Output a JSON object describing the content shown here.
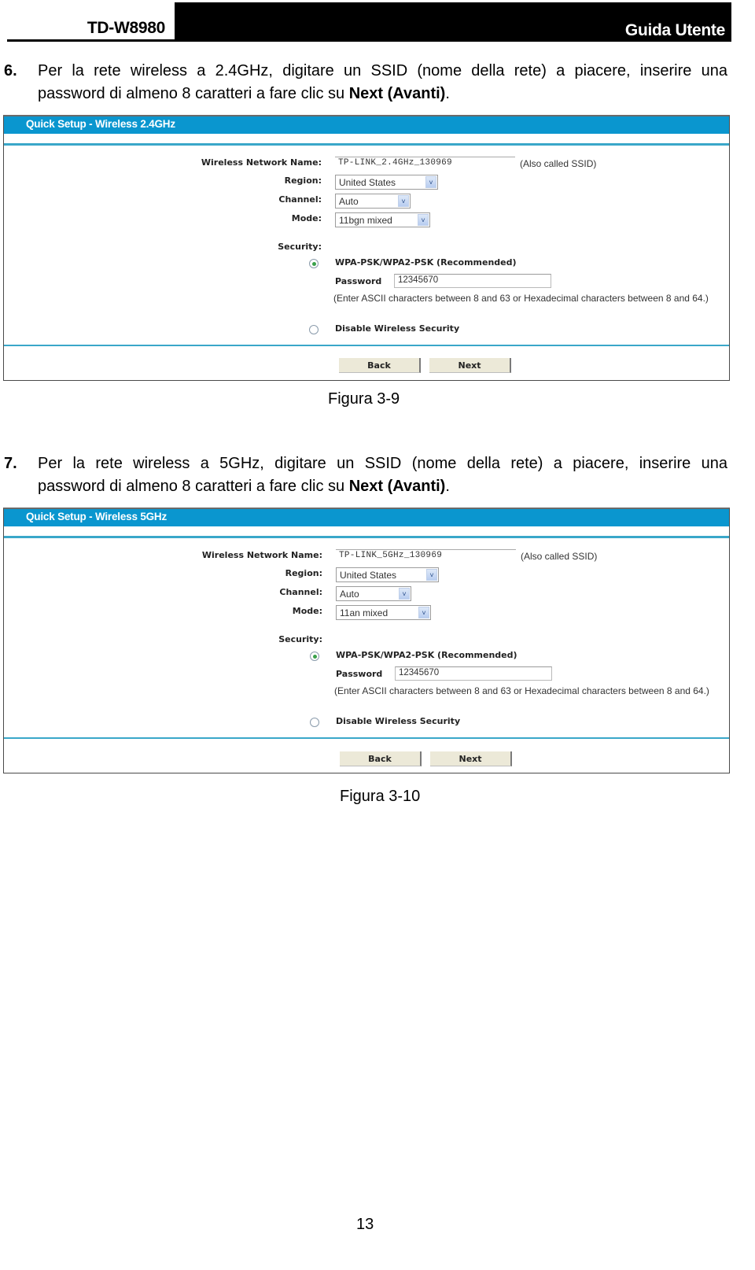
{
  "header": {
    "model": "TD-W8980",
    "doc_title": "Guida Utente"
  },
  "steps": [
    {
      "number": "6.",
      "line1": "Per la rete wireless a 2.4GHz, digitare un SSID (nome della rete) a piacere, inserire una",
      "line2_prefix": "password di almeno 8 caratteri a fare clic su ",
      "line2_bold": "Next (Avanti)",
      "line2_suffix": "."
    },
    {
      "number": "7.",
      "line1": "Per la rete wireless a 5GHz, digitare un SSID (nome della rete) a piacere, inserire una",
      "line2_prefix": "password di almeno 8 caratteri a fare clic su ",
      "line2_bold": "Next (Avanti)",
      "line2_suffix": "."
    }
  ],
  "panels": [
    {
      "title": "Quick Setup - Wireless 2.4GHz",
      "labels": {
        "ssid": "Wireless Network Name:",
        "region": "Region:",
        "channel": "Channel:",
        "mode": "Mode:",
        "security": "Security:",
        "password": "Password"
      },
      "ssid_value": "TP-LINK_2.4GHz_130969",
      "ssid_hint": "(Also called SSID)",
      "region_value": "United States",
      "channel_value": "Auto",
      "mode_value": "11bgn mixed",
      "wpa_option": "WPA-PSK/WPA2-PSK (Recommended)",
      "wpa_selected": true,
      "password_value": "12345670",
      "password_hint": "(Enter ASCII characters between 8 and 63 or Hexadecimal characters between 8 and 64.)",
      "disable_option": "Disable Wireless Security",
      "disable_selected": false,
      "back_label": "Back",
      "next_label": "Next",
      "caption": "Figura 3-9"
    },
    {
      "title": "Quick Setup - Wireless 5GHz",
      "labels": {
        "ssid": "Wireless Network Name:",
        "region": "Region:",
        "channel": "Channel:",
        "mode": "Mode:",
        "security": "Security:",
        "password": "Password"
      },
      "ssid_value": "TP-LINK_5GHz_130969",
      "ssid_hint": "(Also called SSID)",
      "region_value": "United States",
      "channel_value": "Auto",
      "mode_value": "11an mixed",
      "wpa_option": "WPA-PSK/WPA2-PSK (Recommended)",
      "wpa_selected": true,
      "password_value": "12345670",
      "password_hint": "(Enter ASCII characters between 8 and 63 or Hexadecimal characters between 8 and 64.)",
      "disable_option": "Disable Wireless Security",
      "disable_selected": false,
      "back_label": "Back",
      "next_label": "Next",
      "caption": "Figura 3-10"
    }
  ],
  "page_number": "13",
  "colors": {
    "panel_title_bg": "#0a96cf",
    "panel_rule": "#3aa7c9",
    "button_bg": "#ece9d8",
    "radio_selected": "#3aa14a"
  }
}
